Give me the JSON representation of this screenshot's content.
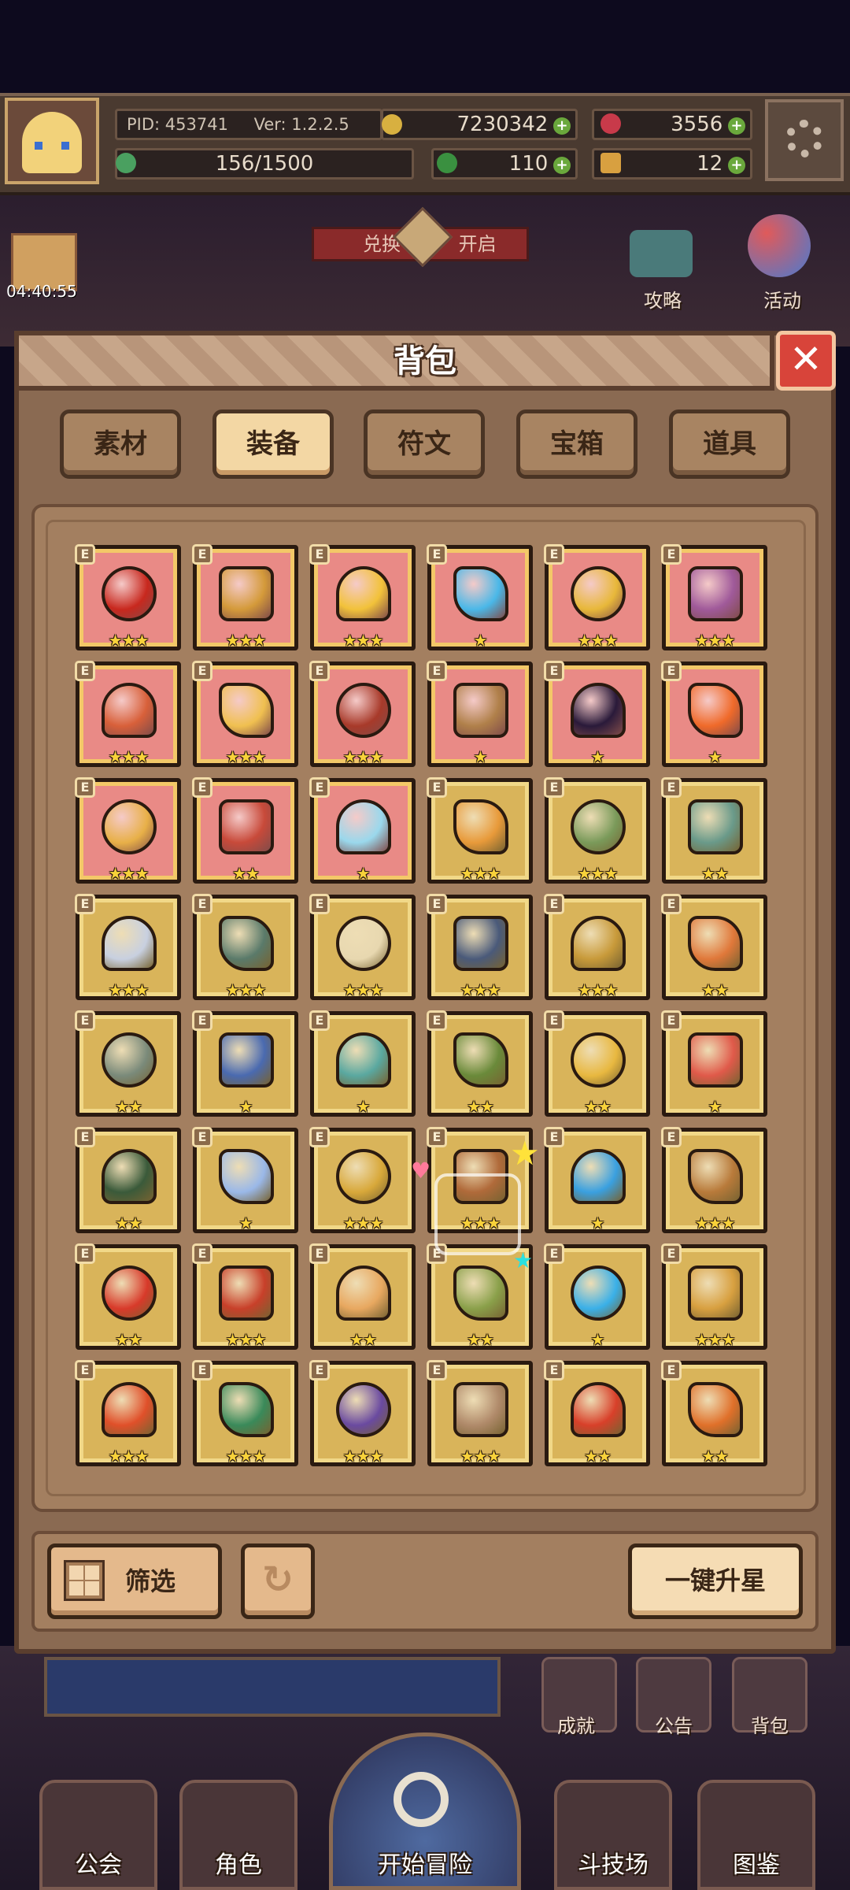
{
  "header": {
    "pid": "PID: 453741",
    "version": "Ver: 1.2.2.5",
    "gold": "7230342",
    "gems": "3556",
    "stamina": "156/1500",
    "clover": "110",
    "keys": "12",
    "timer": "04:40:55",
    "banner_left": "兑换",
    "banner_right": "开启"
  },
  "side_buttons": {
    "strategy": "攻略",
    "events": "活动",
    "achievements": "成就",
    "notice": "公告",
    "bag": "背包"
  },
  "panel": {
    "title": "背包",
    "close_icon": "close-icon",
    "tabs": [
      {
        "label": "素材",
        "active": false
      },
      {
        "label": "装备",
        "active": true
      },
      {
        "label": "符文",
        "active": false
      },
      {
        "label": "宝箱",
        "active": false
      },
      {
        "label": "道具",
        "active": false
      }
    ],
    "equip_badge": "E",
    "items": [
      {
        "name": "crimson-gauntlets",
        "bg": "red",
        "stars": "★★★",
        "color": "#c8281e"
      },
      {
        "name": "wooden-staff",
        "bg": "red",
        "stars": "★★★",
        "color": "#d49a3a"
      },
      {
        "name": "straw-hat",
        "bg": "red",
        "stars": "★★★",
        "color": "#f2c23a"
      },
      {
        "name": "crystal-helm",
        "bg": "red",
        "stars": "★",
        "color": "#4ab8e8"
      },
      {
        "name": "gold-amulet",
        "bg": "red",
        "stars": "★★★",
        "color": "#e8b83a"
      },
      {
        "name": "plaid-necklace",
        "bg": "red",
        "stars": "★★★",
        "color": "#a05a9a"
      },
      {
        "name": "ruby-cap",
        "bg": "red",
        "stars": "★★★",
        "color": "#d8603a"
      },
      {
        "name": "gold-ring",
        "bg": "red",
        "stars": "★★★",
        "color": "#f0c050"
      },
      {
        "name": "battle-axe",
        "bg": "red",
        "stars": "★★★",
        "color": "#a83a2a"
      },
      {
        "name": "bronze-helm",
        "bg": "red",
        "stars": "★",
        "color": "#b0804a"
      },
      {
        "name": "void-orb",
        "bg": "red",
        "stars": "★",
        "color": "#2a1a3a"
      },
      {
        "name": "flame-ring",
        "bg": "red",
        "stars": "★",
        "color": "#f06a2a"
      },
      {
        "name": "horned-crown",
        "bg": "red",
        "stars": "★★★",
        "color": "#e8b048"
      },
      {
        "name": "octopus-cloak",
        "bg": "red",
        "stars": "★★",
        "color": "#c84a3a"
      },
      {
        "name": "heart-pendant",
        "bg": "red",
        "stars": "★",
        "color": "#9ad8ec"
      },
      {
        "name": "gold-scepter",
        "bg": "gold",
        "stars": "★★★",
        "color": "#e89a3a"
      },
      {
        "name": "jade-bow",
        "bg": "gold",
        "stars": "★★★",
        "color": "#7a9a5a"
      },
      {
        "name": "jade-sword",
        "bg": "gold",
        "stars": "★★",
        "color": "#6a9a8a"
      },
      {
        "name": "crossed-swords",
        "bg": "gold",
        "stars": "★★★",
        "color": "#c8d0e0"
      },
      {
        "name": "stone-orb",
        "bg": "gold",
        "stars": "★★★",
        "color": "#5a7a6a"
      },
      {
        "name": "bone-wand",
        "bg": "gold",
        "stars": "★★★",
        "color": "#e8d8b0"
      },
      {
        "name": "dark-sword",
        "bg": "gold",
        "stars": "★★★",
        "color": "#4a5a7a"
      },
      {
        "name": "knight-armor",
        "bg": "gold",
        "stars": "★★★",
        "color": "#c89a3a"
      },
      {
        "name": "flame-armor",
        "bg": "gold",
        "stars": "★★",
        "color": "#e0783a"
      },
      {
        "name": "stone-shield",
        "bg": "gold",
        "stars": "★★",
        "color": "#7a8a7a"
      },
      {
        "name": "magic-lamp",
        "bg": "gold",
        "stars": "★",
        "color": "#4a6ab0"
      },
      {
        "name": "jade-mask",
        "bg": "gold",
        "stars": "★",
        "color": "#5aa8a0"
      },
      {
        "name": "jade-bracelet",
        "bg": "gold",
        "stars": "★★",
        "color": "#6a8a3a"
      },
      {
        "name": "gold-band",
        "bg": "gold",
        "stars": "★★",
        "color": "#e8b840"
      },
      {
        "name": "coral-necklace",
        "bg": "gold",
        "stars": "★",
        "color": "#e05a4a"
      },
      {
        "name": "green-hood",
        "bg": "gold",
        "stars": "★★",
        "color": "#3a5a3a"
      },
      {
        "name": "ice-crown",
        "bg": "gold",
        "stars": "★",
        "color": "#9ab8e8"
      },
      {
        "name": "gold-robe",
        "bg": "gold",
        "stars": "★★★",
        "color": "#d8a83a"
      },
      {
        "name": "treasure-chest",
        "bg": "gold",
        "stars": "★★★",
        "color": "#b06a3a"
      },
      {
        "name": "blue-tunic",
        "bg": "gold",
        "stars": "★",
        "color": "#3aa0e0"
      },
      {
        "name": "ruby-scroll",
        "bg": "gold",
        "stars": "★★★",
        "color": "#b87a3a"
      },
      {
        "name": "red-scroll",
        "bg": "gold",
        "stars": "★★",
        "color": "#d83a2a"
      },
      {
        "name": "red-glove",
        "bg": "gold",
        "stars": "★★★",
        "color": "#c8402a"
      },
      {
        "name": "spiked-ring",
        "bg": "gold",
        "stars": "★★",
        "color": "#e8a860"
      },
      {
        "name": "feather-glove",
        "bg": "gold",
        "stars": "★★",
        "color": "#8aa04a"
      },
      {
        "name": "ice-boot",
        "bg": "gold",
        "stars": "★",
        "color": "#3ab0e8"
      },
      {
        "name": "royal-ring",
        "bg": "gold",
        "stars": "★★★",
        "color": "#d8a040"
      },
      {
        "name": "fire-ring",
        "bg": "gold",
        "stars": "★★★",
        "color": "#e0502a"
      },
      {
        "name": "emerald-ring",
        "bg": "gold",
        "stars": "★★★",
        "color": "#3a8a5a"
      },
      {
        "name": "amethyst-crown",
        "bg": "gold",
        "stars": "★★★",
        "color": "#6a4aa0"
      },
      {
        "name": "diamond-band",
        "bg": "gold",
        "stars": "★★★",
        "color": "#b08a6a"
      },
      {
        "name": "ruby-circlet",
        "bg": "gold",
        "stars": "★★",
        "color": "#d8402a"
      },
      {
        "name": "flame-chest",
        "bg": "gold",
        "stars": "★★",
        "color": "#e0702a"
      }
    ],
    "filter_label": "筛选",
    "upgrade_all_label": "一键升星"
  },
  "bottom_nav": [
    {
      "label": "公会"
    },
    {
      "label": "角色"
    },
    {
      "label": "开始冒险"
    },
    {
      "label": "斗技场"
    },
    {
      "label": "图鉴"
    }
  ]
}
